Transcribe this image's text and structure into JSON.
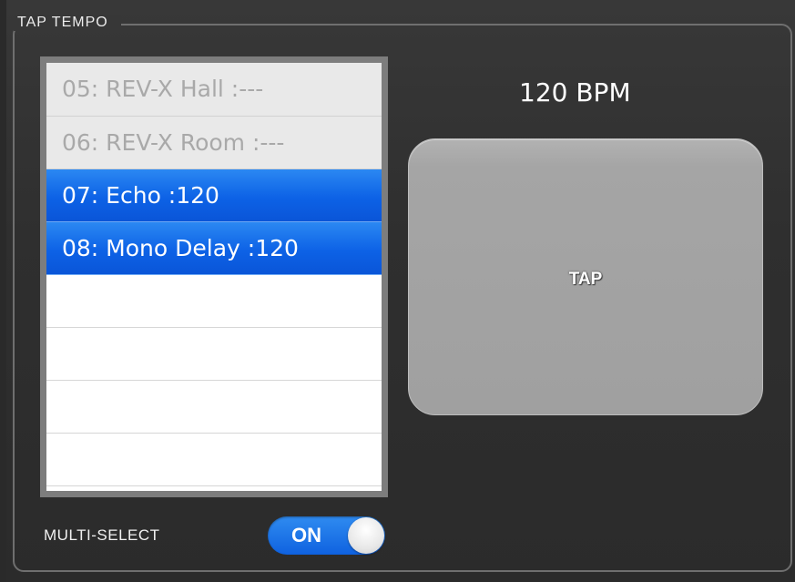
{
  "section": {
    "title": "TAP TEMPO"
  },
  "effects_list": {
    "items": [
      {
        "label": "05: REV-X Hall :---",
        "state": "disabled"
      },
      {
        "label": "06: REV-X Room :---",
        "state": "disabled"
      },
      {
        "label": "07: Echo :120",
        "state": "selected"
      },
      {
        "label": "08: Mono Delay :120",
        "state": "selected"
      },
      {
        "label": "",
        "state": "empty"
      },
      {
        "label": "",
        "state": "empty"
      },
      {
        "label": "",
        "state": "empty"
      },
      {
        "label": "",
        "state": "empty"
      }
    ]
  },
  "tempo": {
    "bpm_display": "120 BPM"
  },
  "tap_button": {
    "label": "TAP"
  },
  "multi_select": {
    "label": "MULTI-SELECT",
    "toggle_text": "ON",
    "on": true
  },
  "colors": {
    "selection": "#0d62e6",
    "panel_bg": "#2b2b2b",
    "tap_button": "#a5a5a5"
  }
}
